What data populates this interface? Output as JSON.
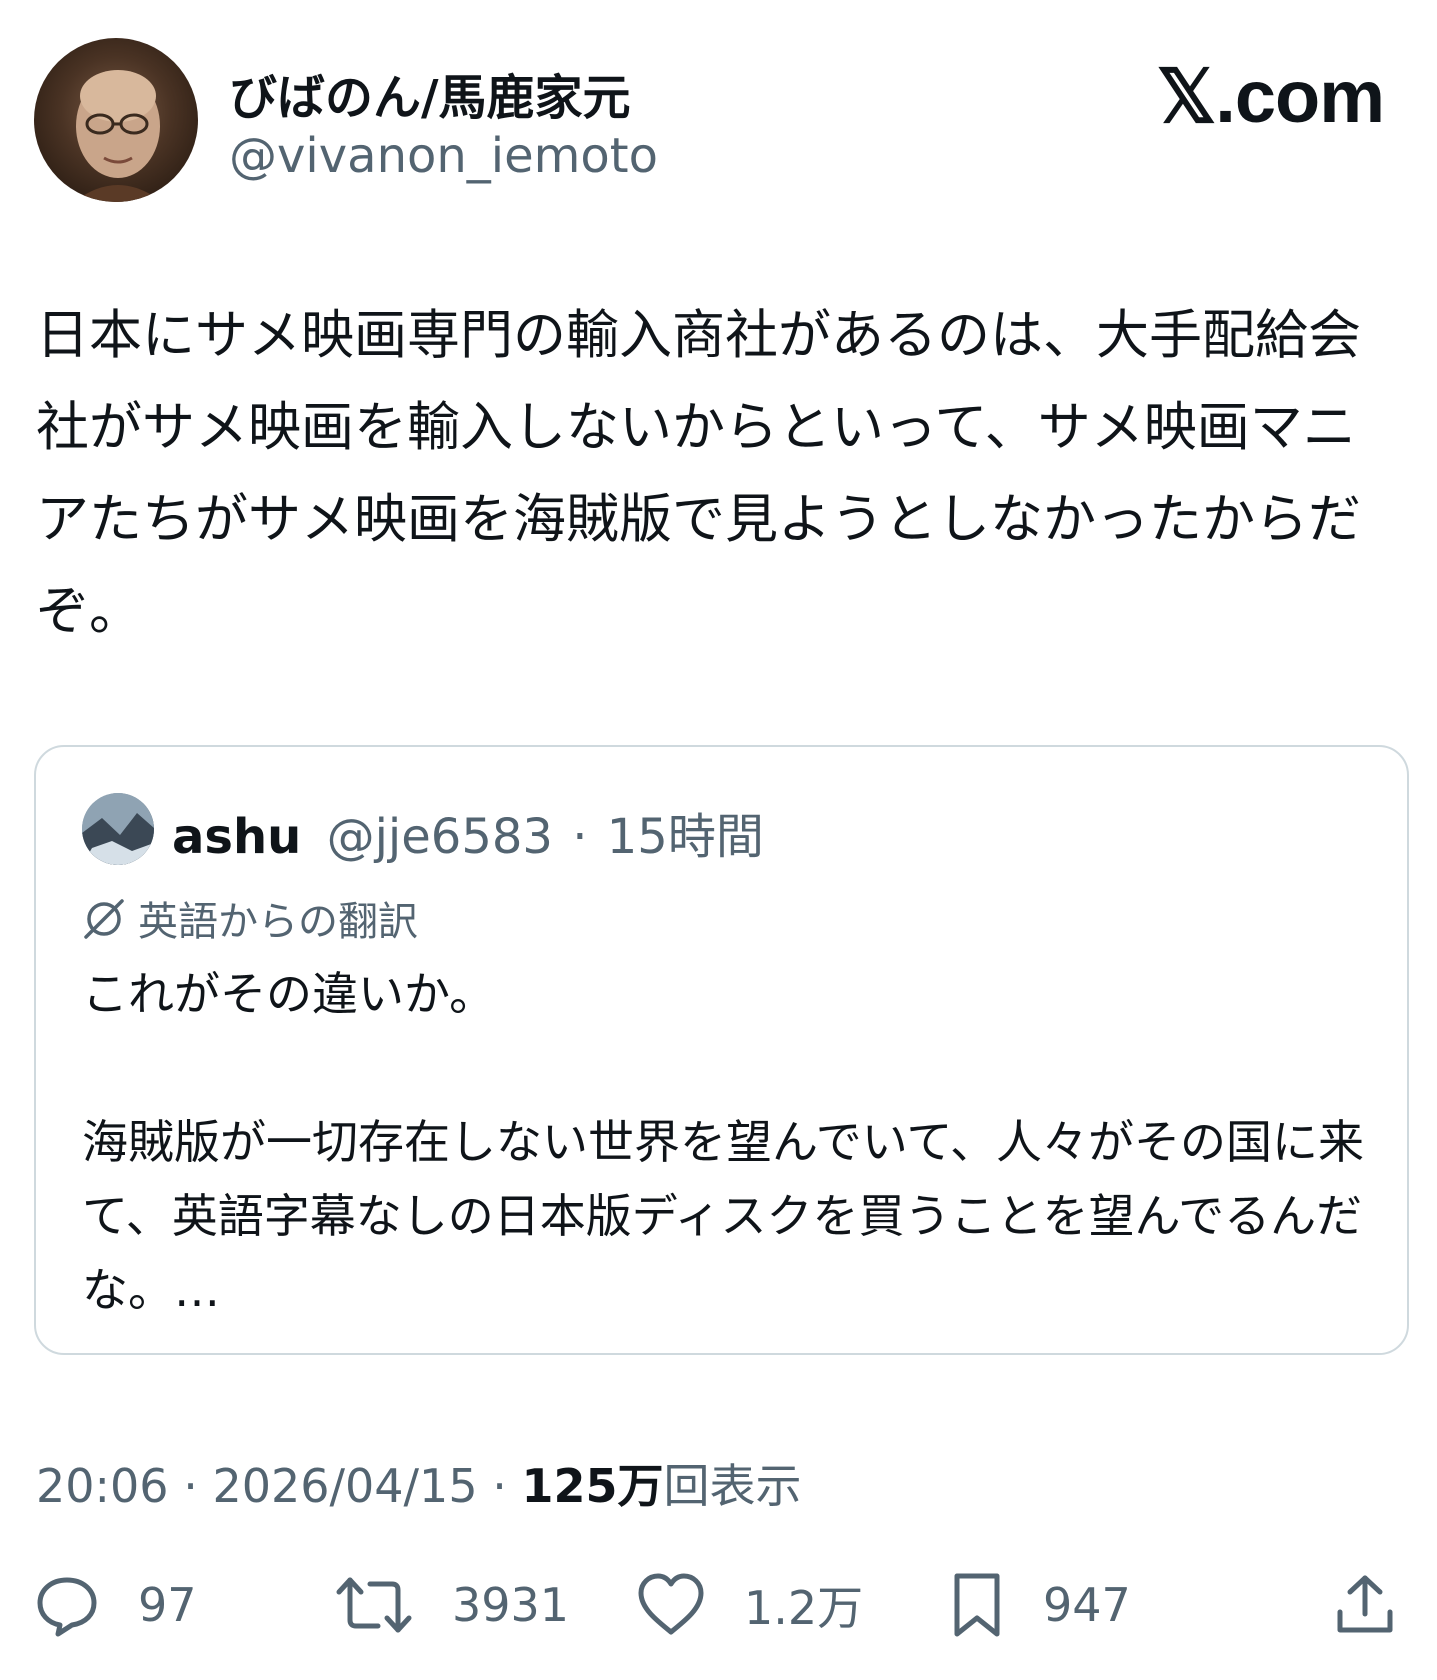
{
  "author": {
    "display_name": "びばのん/馬鹿家元",
    "handle": "@vivanon_iemoto"
  },
  "brand": "𝕏.com",
  "tweet": {
    "text": "日本にサメ映画専門の輸入商社があるのは、大手配給会社がサメ映画を輸入しないからといって、サメ映画マニアたちがサメ映画を海賊版で見ようとしなかったからだぞ。"
  },
  "quote": {
    "name": "ashu",
    "handle": "@jje6583",
    "separator": "·",
    "time": "15時間",
    "translation_label": "英語からの翻訳",
    "paragraph1": "これがその違いか。",
    "paragraph2": "海賊版が一切存在しない世界を望んでいて、人々がその国に来て、英語字幕なしの日本版ディスクを買うことを望んでるんだな。…"
  },
  "meta": {
    "time": "20:06",
    "sep": "·",
    "date": "2026/04/15",
    "views_count": "125万",
    "views_label": "回表示"
  },
  "actions": {
    "replies": "97",
    "reposts": "3931",
    "likes": "1.2万",
    "bookmarks": "947"
  },
  "icons": {
    "reply": "reply-icon",
    "repost": "repost-icon",
    "like": "heart-icon",
    "bookmark": "bookmark-icon",
    "share": "share-icon",
    "translate": "translate-icon"
  },
  "colors": {
    "text": "#0f1419",
    "secondary": "#536471",
    "border": "#cfd9de"
  }
}
